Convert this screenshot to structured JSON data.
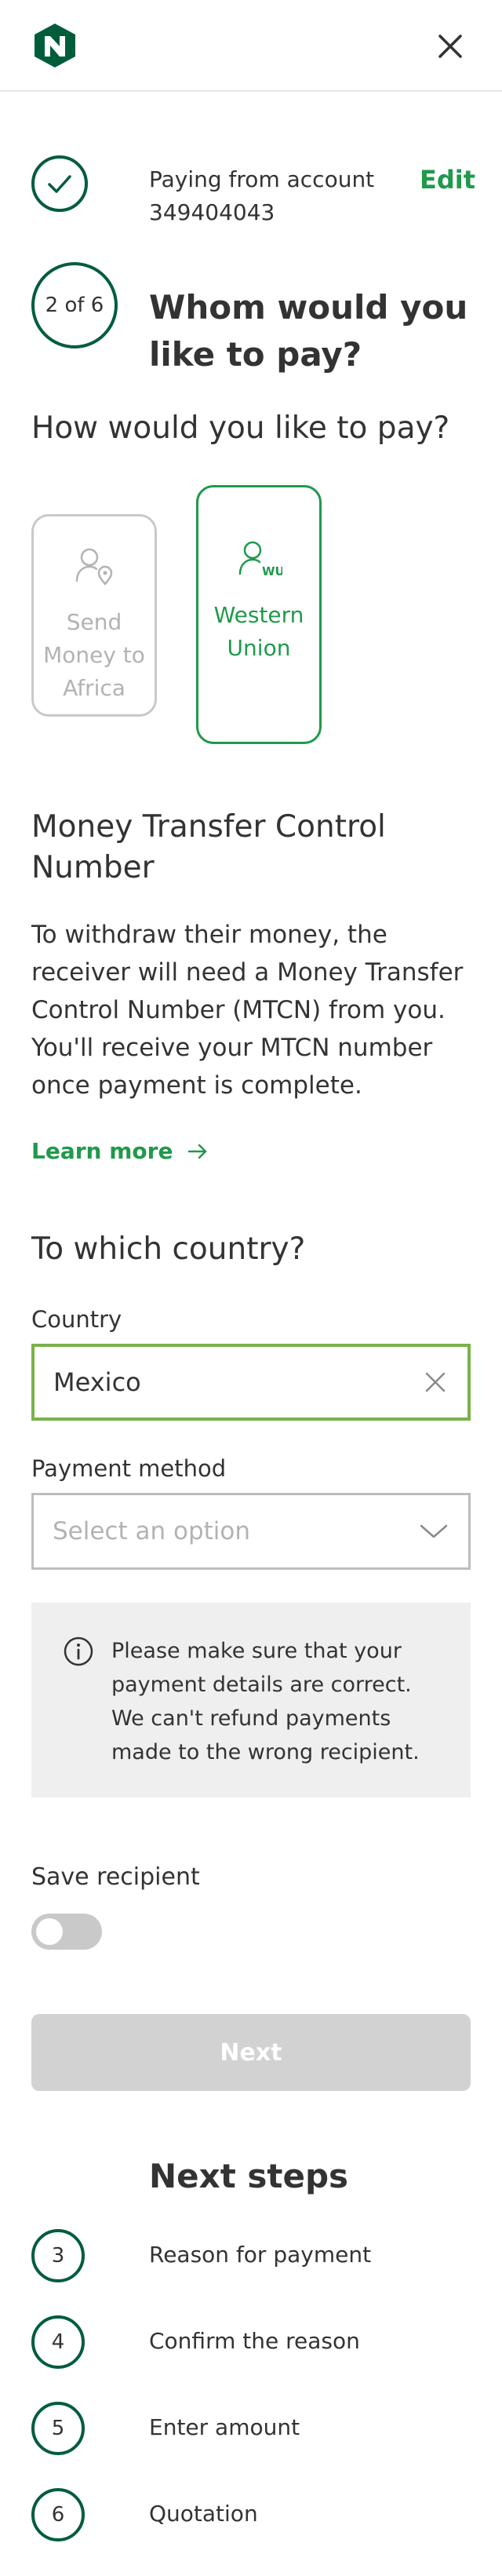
{
  "header": {
    "logo_icon": "nedbank-logo-icon",
    "close_icon": "close-icon"
  },
  "progress": {
    "completed_step_icon": "check-icon",
    "paying_from_label": "Paying from account",
    "account_number": "349404043",
    "edit_label": "Edit",
    "current_step": "2 of 6",
    "title_line1": "Whom would you",
    "title_line2": "like to pay?"
  },
  "payment_type": {
    "question": "How would you like to pay?",
    "options": [
      {
        "label_line1": "Send",
        "label_line2": "Money to",
        "label_line3": "Africa",
        "icon": "person-location-icon",
        "selected": false
      },
      {
        "label_line1": "Western",
        "label_line2": "Union",
        "icon": "person-western-union-icon",
        "selected": true
      }
    ]
  },
  "mtcn": {
    "title_line1": "Money Transfer Control",
    "title_line2": "Number",
    "body_line1": "To withdraw their money, the",
    "body_line2": "receiver will need a Money Transfer",
    "body_line3": "Control Number (MTCN) from you.",
    "body_line4": "You'll receive your MTCN number",
    "body_line5": "once payment is complete.",
    "learn_more": "Learn more",
    "learn_more_icon": "arrow-right-icon"
  },
  "destination": {
    "question": "To which country?",
    "country_label": "Country",
    "country_value": "Mexico",
    "clear_icon": "clear-icon",
    "payment_method_label": "Payment method",
    "payment_method_placeholder": "Select an option",
    "chevron_icon": "chevron-down-icon"
  },
  "info": {
    "icon": "info-icon",
    "line1": "Please make sure that your",
    "line2": "payment details are correct.",
    "line3": "We can't refund payments",
    "line4": "made to the wrong recipient."
  },
  "save_recipient": {
    "label": "Save recipient",
    "enabled": false
  },
  "next_button": {
    "label": "Next",
    "disabled": true
  },
  "next_steps": {
    "title": "Next steps",
    "steps": [
      {
        "number": "3",
        "label": "Reason for payment"
      },
      {
        "number": "4",
        "label": "Confirm the reason"
      },
      {
        "number": "5",
        "label": "Enter amount"
      },
      {
        "number": "6",
        "label": "Quotation"
      }
    ]
  },
  "colors": {
    "brand_green": "#005d3b",
    "accent_green": "#1f9a4b",
    "input_focus_border": "#7ab24a",
    "disabled_button": "#d2d2d2",
    "info_background": "#efefef"
  }
}
